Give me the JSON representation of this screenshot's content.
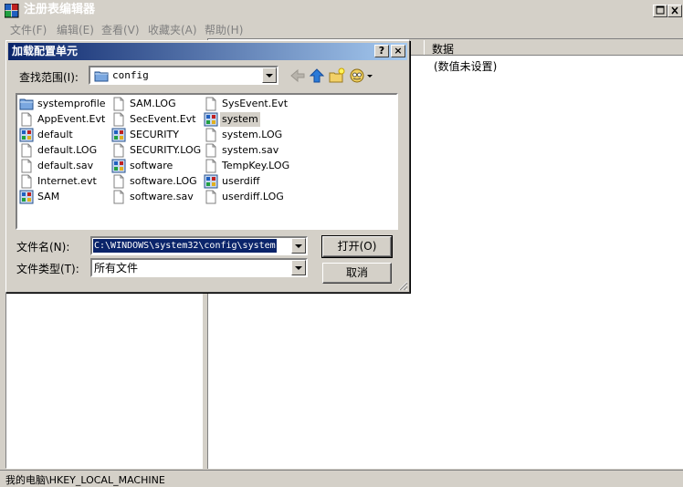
{
  "window": {
    "title": "注册表编辑器"
  },
  "menu": [
    "文件(F)",
    "编辑(E)",
    "查看(V)",
    "收藏夹(A)",
    "帮助(H)"
  ],
  "list_header": {
    "data_column": "数据"
  },
  "data_value": "(数值未设置)",
  "status_bar": "我的电脑\\HKEY_LOCAL_MACHINE",
  "dialog": {
    "title": "加载配置单元",
    "help_button": "?",
    "close_button": "×",
    "look_in_label": "查找范围(I):",
    "look_in_value": "config",
    "files": [
      {
        "name": "systemprofile",
        "icon": "folder-icon",
        "selected": false
      },
      {
        "name": "AppEvent.Evt",
        "icon": "file-icon",
        "selected": false
      },
      {
        "name": "default",
        "icon": "hive-icon",
        "selected": false
      },
      {
        "name": "default.LOG",
        "icon": "file-icon",
        "selected": false
      },
      {
        "name": "default.sav",
        "icon": "file-icon",
        "selected": false
      },
      {
        "name": "Internet.evt",
        "icon": "file-icon",
        "selected": false
      },
      {
        "name": "SAM",
        "icon": "hive-icon",
        "selected": false
      },
      {
        "name": "SAM.LOG",
        "icon": "file-icon",
        "selected": false
      },
      {
        "name": "SecEvent.Evt",
        "icon": "file-icon",
        "selected": false
      },
      {
        "name": "SECURITY",
        "icon": "hive-icon",
        "selected": false
      },
      {
        "name": "SECURITY.LOG",
        "icon": "file-icon",
        "selected": false
      },
      {
        "name": "software",
        "icon": "hive-icon",
        "selected": false
      },
      {
        "name": "software.LOG",
        "icon": "file-icon",
        "selected": false
      },
      {
        "name": "software.sav",
        "icon": "file-icon",
        "selected": false
      },
      {
        "name": "SysEvent.Evt",
        "icon": "file-icon",
        "selected": false
      },
      {
        "name": "system",
        "icon": "hive-icon",
        "selected": true
      },
      {
        "name": "system.LOG",
        "icon": "file-icon",
        "selected": false
      },
      {
        "name": "system.sav",
        "icon": "file-icon",
        "selected": false
      },
      {
        "name": "TempKey.LOG",
        "icon": "file-icon",
        "selected": false
      },
      {
        "name": "userdiff",
        "icon": "hive-icon",
        "selected": false
      },
      {
        "name": "userdiff.LOG",
        "icon": "file-icon",
        "selected": false
      }
    ],
    "filename_label": "文件名(N):",
    "filename_value": "C:\\WINDOWS\\system32\\config\\system",
    "filetype_label": "文件类型(T):",
    "filetype_value": "所有文件",
    "open_button": "打开(O)",
    "cancel_button": "取消"
  },
  "colors": {
    "dialog_title_start": "#0a246a",
    "dialog_title_end": "#a6caf0",
    "selection": "#0a246a",
    "face": "#d4d0c8"
  }
}
